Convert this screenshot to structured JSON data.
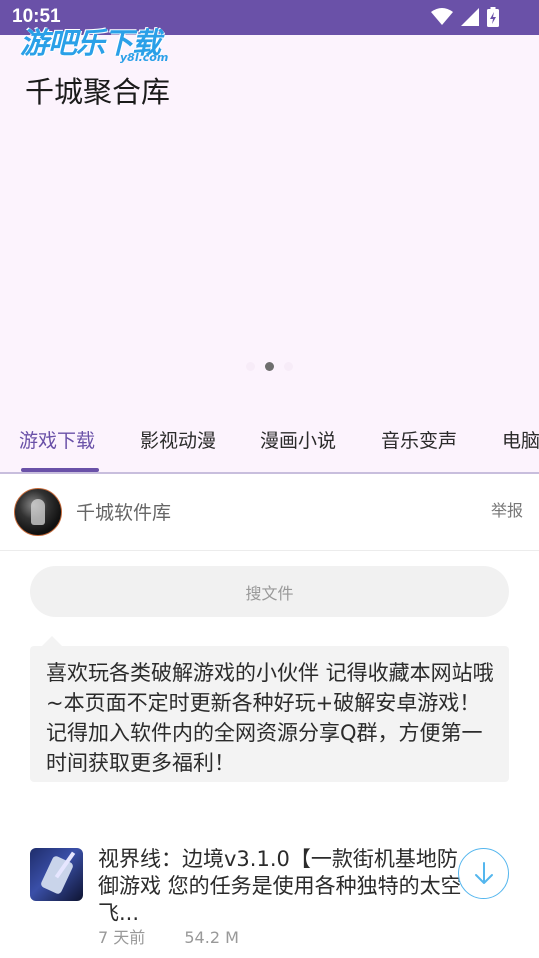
{
  "status_bar": {
    "time": "10:51",
    "icons": [
      "wifi-icon",
      "signal-icon",
      "battery-charging-icon"
    ]
  },
  "watermark": {
    "text": "游吧乐下载",
    "sub": "y8l.com"
  },
  "banner": {
    "title": "千城聚合库",
    "page_indicator": {
      "pages": 3,
      "active": 1
    }
  },
  "tabs": [
    {
      "label": "游戏下载",
      "active": true
    },
    {
      "label": "影视动漫"
    },
    {
      "label": "漫画小说"
    },
    {
      "label": "音乐变声"
    },
    {
      "label": "电脑"
    }
  ],
  "profile": {
    "name": "千城软件库",
    "report_label": "举报"
  },
  "search": {
    "placeholder": "搜文件"
  },
  "notice": {
    "text": "喜欢玩各类破解游戏的小伙伴 记得收藏本网站哦~本页面不定时更新各种好玩+破解安卓游戏！记得加入软件内的全网资源分享Q群，方便第一时间获取更多福利！"
  },
  "items": [
    {
      "title": "视界线：边境v3.1.0【一款街机基地防御游戏 您的任务是使用各种独特的太空飞...",
      "time": "7 天前",
      "size": "54.2 M"
    }
  ],
  "colors": {
    "accent": "#6a51a8",
    "banner_bg": "#fcf3fd",
    "download_blue": "#54b6ee"
  }
}
